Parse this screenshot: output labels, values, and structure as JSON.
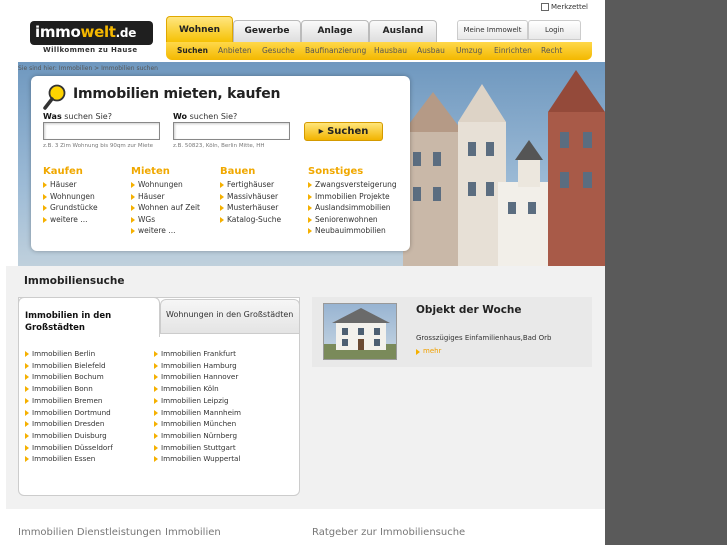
{
  "header": {
    "logo_main": "immo",
    "logo_accent": "welt",
    "logo_tld": ".de",
    "tagline": "Willkommen zu Hause",
    "merkzettel": "Merkzettel"
  },
  "nav": {
    "tabs": [
      {
        "label": "Wohnen",
        "active": true
      },
      {
        "label": "Gewerbe",
        "active": false
      },
      {
        "label": "Anlage",
        "active": false
      },
      {
        "label": "Ausland",
        "active": false
      }
    ],
    "account": [
      "Meine Immowelt",
      "Login"
    ],
    "subnav": [
      {
        "label": "Suchen",
        "active": true
      },
      {
        "label": "Anbieten",
        "active": false
      },
      {
        "label": "Gesuche",
        "active": false
      },
      {
        "label": "Baufinanzierung",
        "active": false
      },
      {
        "label": "Hausbau",
        "active": false
      },
      {
        "label": "Ausbau",
        "active": false
      },
      {
        "label": "Umzug",
        "active": false
      },
      {
        "label": "Einrichten",
        "active": false
      },
      {
        "label": "Recht",
        "active": false
      }
    ]
  },
  "breadcrumb": "Sie sind hier: Immobilien > Immobilien suchen",
  "search": {
    "title": "Immobilien mieten, kaufen",
    "was_bold": "Was",
    "was_rest": " suchen Sie?",
    "was_hint": "z.B. 3 Zim Wohnung bis 90qm zur Miete",
    "wo_bold": "Wo",
    "wo_rest": " suchen Sie?",
    "wo_hint": "z.B. 50823, Köln, Berlin Mitte, HH",
    "button": "Suchen",
    "columns": [
      {
        "heading": "Kaufen",
        "items": [
          "Häuser",
          "Wohnungen",
          "Grundstücke",
          "weitere ..."
        ]
      },
      {
        "heading": "Mieten",
        "items": [
          "Wohnungen",
          "Häuser",
          "Wohnen auf Zeit",
          "WGs",
          "weitere ..."
        ]
      },
      {
        "heading": "Bauen",
        "items": [
          "Fertighäuser",
          "Massivhäuser",
          "Musterhäuser",
          "Katalog-Suche"
        ]
      },
      {
        "heading": "Sonstiges",
        "items": [
          "Zwangsversteigerung",
          "Immobilien Projekte",
          "Auslandsimmobilien",
          "Seniorenwohnen",
          "Neubauimmobilien"
        ]
      }
    ]
  },
  "immosuche": {
    "title": "Immobiliensuche",
    "tab_active": "Immobilien in den Großstädten",
    "tab_other": "Wohnungen in den Großstädten",
    "cities_left": [
      "Immobilien Berlin",
      "Immobilien Bielefeld",
      "Immobilien Bochum",
      "Immobilien Bonn",
      "Immobilien Bremen",
      "Immobilien Dortmund",
      "Immobilien Dresden",
      "Immobilien Duisburg",
      "Immobilien Düsseldorf",
      "Immobilien Essen"
    ],
    "cities_right": [
      "Immobilien Frankfurt",
      "Immobilien Hamburg",
      "Immobilien Hannover",
      "Immobilien Köln",
      "Immobilien Leipzig",
      "Immobilien Mannheim",
      "Immobilien München",
      "Immobilien Nürnberg",
      "Immobilien Stuttgart",
      "Immobilien Wuppertal"
    ]
  },
  "objekt": {
    "title": "Objekt der Woche",
    "desc": "Grosszügiges Einfamilienhaus,Bad Orb",
    "more": "mehr"
  },
  "footer": [
    "Immobilien Dienstleistungen",
    "Immobilien",
    "Ratgeber zur Immobiliensuche"
  ],
  "colors": {
    "accent": "#f5b800",
    "heading_orange": "#f0a800",
    "side_gray": "#5a5a5a"
  }
}
